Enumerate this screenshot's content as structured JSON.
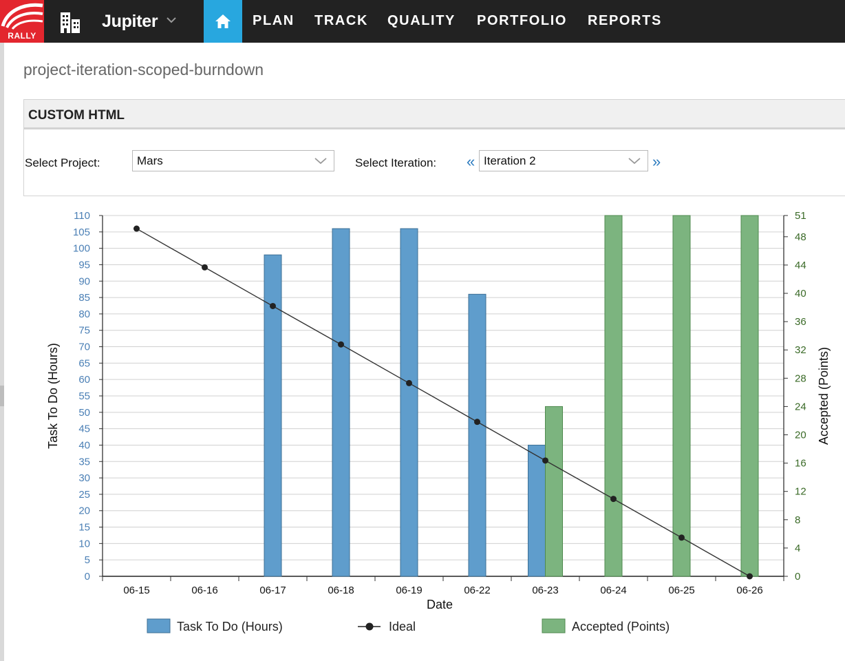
{
  "app": {
    "logo_text": "RALLY",
    "workspace": "Jupiter"
  },
  "nav": {
    "items": [
      "PLAN",
      "TRACK",
      "QUALITY",
      "PORTFOLIO",
      "REPORTS"
    ]
  },
  "page": {
    "title": "project-iteration-scoped-burndown"
  },
  "panel": {
    "header": "CUSTOM HTML",
    "project_label": "Select Project:",
    "project_value": "Mars",
    "iteration_label": "Select Iteration:",
    "iteration_value": "Iteration 2",
    "prev": "«",
    "next": "»"
  },
  "colors": {
    "nav_bg": "#222222",
    "logo_red": "#e3262e",
    "home_blue": "#28a7df",
    "bar_blue": "#5f9dcc",
    "bar_green": "#7cb47f",
    "ideal_line": "#333333"
  },
  "chart_data": {
    "type": "bar",
    "categories": [
      "06-15",
      "06-16",
      "06-17",
      "06-18",
      "06-19",
      "06-22",
      "06-23",
      "06-24",
      "06-25",
      "06-26"
    ],
    "xlabel": "Date",
    "ylabel_left": "Task To Do (Hours)",
    "ylabel_right": "Accepted (Points)",
    "y_left_range": [
      0,
      110
    ],
    "y_left_ticks": [
      "0",
      "5",
      "10",
      "15",
      "20",
      "25",
      "30",
      "35",
      "40",
      "45",
      "50",
      "55",
      "60",
      "65",
      "70",
      "75",
      "80",
      "85",
      "90",
      "95",
      "100",
      "105",
      "110"
    ],
    "y_right_range": [
      0,
      51
    ],
    "y_right_ticks": [
      "0",
      "4",
      "8",
      "12",
      "16",
      "20",
      "24",
      "28",
      "32",
      "36",
      "40",
      "44",
      "48",
      "51"
    ],
    "grid": true,
    "legend_position": "bottom",
    "series": [
      {
        "name": "Task To Do (Hours)",
        "kind": "bar",
        "axis": "left",
        "values": [
          null,
          null,
          98,
          106,
          106,
          86,
          40,
          null,
          null,
          null
        ]
      },
      {
        "name": "Ideal",
        "kind": "line",
        "axis": "left",
        "values": [
          106,
          94.2,
          82.4,
          70.7,
          58.9,
          47.1,
          35.3,
          23.6,
          11.8,
          0
        ]
      },
      {
        "name": "Accepted (Points)",
        "kind": "bar",
        "axis": "right",
        "values": [
          null,
          null,
          null,
          null,
          null,
          null,
          24,
          51,
          51,
          51
        ]
      }
    ]
  }
}
